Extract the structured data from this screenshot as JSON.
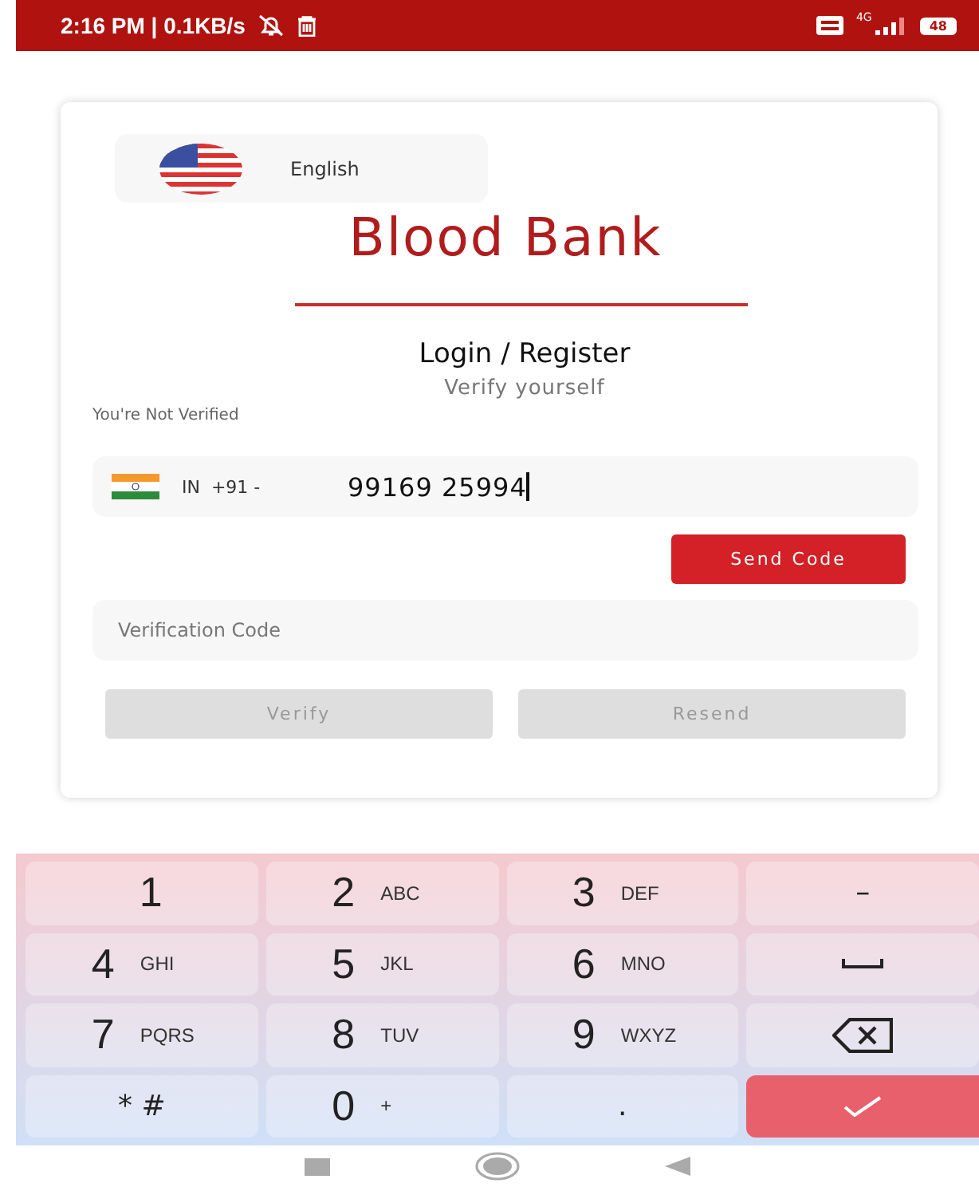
{
  "status_bar": {
    "time": "2:16 PM | 0.1KB/s",
    "network": "4G",
    "battery": "48"
  },
  "language": {
    "label": "English"
  },
  "title": "Blood Bank",
  "heading": "Login / Register",
  "subheading": "Verify yourself",
  "verification_status": "You're Not Verified",
  "phone": {
    "country": "IN",
    "code": "+91",
    "caret": "-",
    "value": "99169 25994"
  },
  "send_button": {
    "label": "Send Code",
    "disabled": false
  },
  "code_field": {
    "placeholder": "Verification Code"
  },
  "actions": [
    {
      "label": "Verify",
      "disabled": true
    },
    {
      "label": "Resend",
      "disabled": true
    }
  ],
  "keyboard": [
    {
      "kind": "digit",
      "main": "1"
    },
    {
      "kind": "digit",
      "main": "2",
      "sub": "ABC"
    },
    {
      "kind": "digit",
      "main": "3",
      "sub": "DEF"
    },
    {
      "kind": "symbol",
      "main": "–"
    },
    {
      "kind": "digit",
      "main": "4",
      "sub": "GHI"
    },
    {
      "kind": "digit",
      "main": "5",
      "sub": "JKL"
    },
    {
      "kind": "digit",
      "main": "6",
      "sub": "MNO"
    },
    {
      "kind": "space"
    },
    {
      "kind": "digit",
      "main": "7",
      "sub": "PQRS"
    },
    {
      "kind": "digit",
      "main": "8",
      "sub": "TUV"
    },
    {
      "kind": "digit",
      "main": "9",
      "sub": "WXYZ"
    },
    {
      "kind": "backspace"
    },
    {
      "kind": "small",
      "main": "* #"
    },
    {
      "kind": "digit",
      "main": "0",
      "sub": "+"
    },
    {
      "kind": "small",
      "main": "."
    },
    {
      "kind": "enter"
    }
  ]
}
